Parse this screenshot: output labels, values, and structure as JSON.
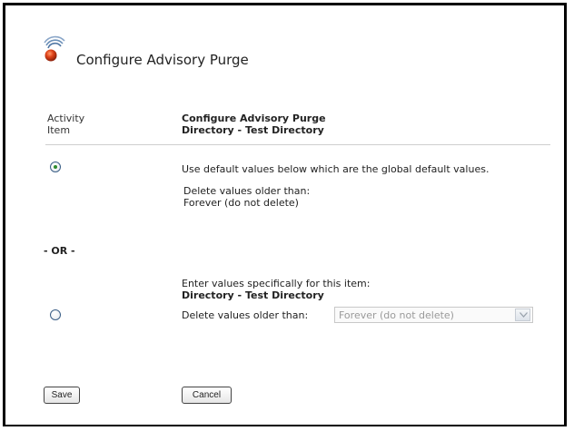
{
  "page": {
    "title": "Configure Advisory Purge"
  },
  "header": {
    "left_col_line1": "Activity",
    "left_col_line2": "Item",
    "right_col_line1": "Configure Advisory Purge",
    "right_col_line2": "Directory - Test Directory"
  },
  "option_default": {
    "selected": true,
    "label": "Use default values below which are the global default values.",
    "delete_label": "Delete values older than:",
    "delete_value": "Forever (do not delete)"
  },
  "separator": "- OR -",
  "option_specific": {
    "selected": false,
    "label": "Enter values specifically for this item:",
    "item_name": "Directory - Test Directory",
    "delete_label": "Delete values older than:",
    "select_value": "Forever (do not delete)"
  },
  "buttons": {
    "save": "Save",
    "cancel": "Cancel"
  },
  "colors": {
    "logo_orb": "#e0441a",
    "logo_waves": "#6a8fb8",
    "radio_dot": "#2e8b2e"
  }
}
